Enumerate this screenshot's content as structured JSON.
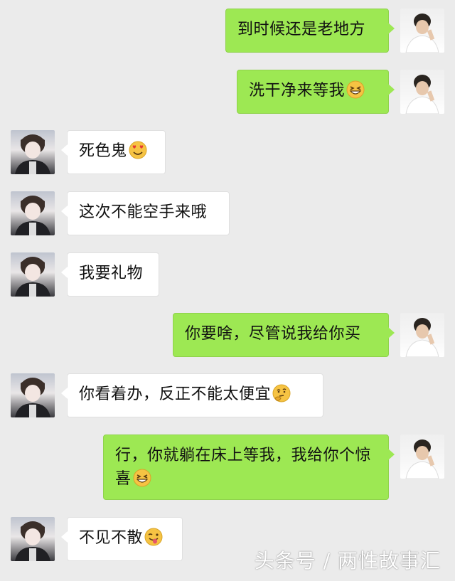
{
  "messages": [
    {
      "sender": "me",
      "text": "到时候还是老地方",
      "emoji": ""
    },
    {
      "sender": "me",
      "text": "洗干净来等我",
      "emoji": "grin-squint-emoji"
    },
    {
      "sender": "other",
      "text": "死色鬼",
      "emoji": "heart-eyes-emoji"
    },
    {
      "sender": "other",
      "text": "这次不能空手来哦",
      "emoji": ""
    },
    {
      "sender": "other",
      "text": "我要礼物",
      "emoji": ""
    },
    {
      "sender": "me",
      "text": "你要啥，尽管说我给你买",
      "emoji": ""
    },
    {
      "sender": "other",
      "text": "你看着办，反正不能太便宜",
      "emoji": "thinking-emoji"
    },
    {
      "sender": "me",
      "text": "行，你就躺在床上等我，我给你个惊喜",
      "emoji": "grin-squint-emoji"
    },
    {
      "sender": "other",
      "text": "不见不散",
      "emoji": "wink-tongue-emoji"
    }
  ],
  "watermark": "头条号 / 两性故事汇",
  "colors": {
    "background": "#ebebeb",
    "my_bubble": "#9de853",
    "their_bubble": "#ffffff",
    "emoji": "#f6c343"
  }
}
